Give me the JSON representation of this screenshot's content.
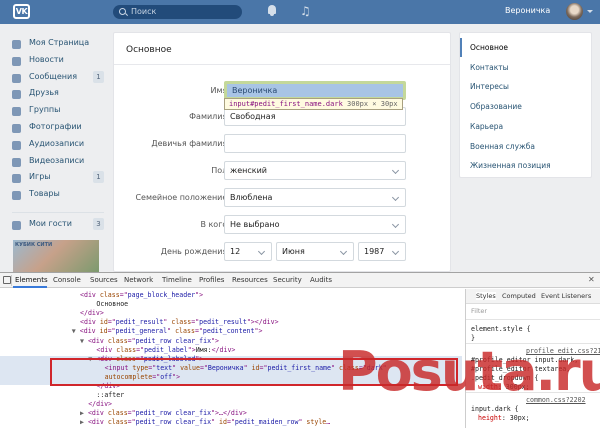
{
  "topbar": {
    "logo": "VK",
    "search_placeholder": "Поиск",
    "user_name": "Вероничка"
  },
  "left_menu": {
    "items": [
      {
        "label": "Моя Страница",
        "icon": "home-icon"
      },
      {
        "label": "Новости",
        "icon": "news-icon"
      },
      {
        "label": "Сообщения",
        "icon": "messages-icon",
        "count": "1"
      },
      {
        "label": "Друзья",
        "icon": "friends-icon"
      },
      {
        "label": "Группы",
        "icon": "groups-icon"
      },
      {
        "label": "Фотографии",
        "icon": "photos-icon"
      },
      {
        "label": "Аудиозаписи",
        "icon": "audio-icon"
      },
      {
        "label": "Видеозаписи",
        "icon": "video-icon"
      },
      {
        "label": "Игры",
        "icon": "games-icon",
        "count": "1"
      },
      {
        "label": "Товары",
        "icon": "goods-icon"
      }
    ],
    "guests": {
      "label": "Мои гости",
      "count": "3"
    },
    "ad_text": "КУБИК СИТИ"
  },
  "main": {
    "title": "Основное",
    "fields": {
      "first_name": {
        "label": "Имя:",
        "value": "Вероничка"
      },
      "last_name": {
        "label": "Фамилия:",
        "value": "Свободная"
      },
      "maiden_name": {
        "label": "Девичья фамилия:",
        "value": ""
      },
      "gender": {
        "label": "Пол:",
        "value": "женский"
      },
      "relationship": {
        "label": "Семейное положение:",
        "value": "Влюблена"
      },
      "with_whom": {
        "label": "В кого:",
        "value": "Не выбрано"
      },
      "birthday": {
        "label": "День рождения:",
        "day": "12",
        "month": "Июня",
        "year": "1987"
      }
    },
    "tooltip": {
      "selector": "input#pedit_first_name.dark",
      "size": "300px × 30px"
    }
  },
  "right_menu": {
    "items": [
      {
        "label": "Основное",
        "active": true
      },
      {
        "label": "Контакты"
      },
      {
        "label": "Интересы"
      },
      {
        "label": "Образование"
      },
      {
        "label": "Карьера"
      },
      {
        "label": "Военная служба"
      },
      {
        "label": "Жизненная позиция"
      }
    ]
  },
  "devtools": {
    "tabs": [
      "Elements",
      "Console",
      "Sources",
      "Network",
      "Timeline",
      "Profiles",
      "Resources",
      "Security",
      "Audits"
    ],
    "active_tab": "Elements",
    "dom_lines": [
      {
        "indent": 10,
        "tri": "",
        "parts": [
          [
            "t",
            "<div "
          ],
          [
            "a",
            "class"
          ],
          [
            "t",
            "=\""
          ],
          [
            "v",
            "page_block_header"
          ],
          [
            "t",
            "\">"
          ]
        ]
      },
      {
        "indent": 12,
        "tri": "",
        "parts": [
          [
            "x",
            "Основное"
          ]
        ]
      },
      {
        "indent": 10,
        "tri": "",
        "parts": [
          [
            "t",
            "</div>"
          ]
        ]
      },
      {
        "indent": 10,
        "tri": "",
        "parts": [
          [
            "t",
            "<div "
          ],
          [
            "a",
            "id"
          ],
          [
            "t",
            "=\""
          ],
          [
            "v",
            "pedit_result"
          ],
          [
            "t",
            "\" "
          ],
          [
            "a",
            "class"
          ],
          [
            "t",
            "=\""
          ],
          [
            "v",
            "pedit_result"
          ],
          [
            "t",
            "\"></div>"
          ]
        ]
      },
      {
        "indent": 9,
        "tri": "▼",
        "parts": [
          [
            "t",
            "<div "
          ],
          [
            "a",
            "id"
          ],
          [
            "t",
            "=\""
          ],
          [
            "v",
            "pedit_general"
          ],
          [
            "t",
            "\" "
          ],
          [
            "a",
            "class"
          ],
          [
            "t",
            "=\""
          ],
          [
            "v",
            "pedit_content"
          ],
          [
            "t",
            "\">"
          ]
        ]
      },
      {
        "indent": 10,
        "tri": "▼",
        "parts": [
          [
            "t",
            "<div "
          ],
          [
            "a",
            "class"
          ],
          [
            "t",
            "=\""
          ],
          [
            "v",
            "pedit_row clear_fix"
          ],
          [
            "t",
            "\">"
          ]
        ]
      },
      {
        "indent": 12,
        "tri": "",
        "parts": [
          [
            "t",
            "<div "
          ],
          [
            "a",
            "class"
          ],
          [
            "t",
            "=\""
          ],
          [
            "v",
            "pedit_label"
          ],
          [
            "t",
            "\">"
          ],
          [
            "x",
            "Имя:"
          ],
          [
            "t",
            "</div>"
          ]
        ]
      },
      {
        "indent": 11,
        "tri": "▼",
        "parts": [
          [
            "t",
            "<div "
          ],
          [
            "a",
            "class"
          ],
          [
            "t",
            "=\""
          ],
          [
            "v",
            "pedit_labeled"
          ],
          [
            "t",
            "\">"
          ]
        ]
      },
      {
        "indent": 13,
        "tri": "",
        "parts": [
          [
            "t",
            "<input "
          ],
          [
            "a",
            "type"
          ],
          [
            "t",
            "=\""
          ],
          [
            "v",
            "text"
          ],
          [
            "t",
            "\" "
          ],
          [
            "a",
            "value"
          ],
          [
            "t",
            "=\""
          ],
          [
            "v",
            "Вероничка"
          ],
          [
            "t",
            "\" "
          ],
          [
            "a",
            "id"
          ],
          [
            "t",
            "=\""
          ],
          [
            "v",
            "pedit_first_name"
          ],
          [
            "t",
            "\" "
          ],
          [
            "a",
            "class"
          ],
          [
            "t",
            "=\""
          ],
          [
            "v",
            "dark"
          ],
          [
            "t",
            "\""
          ]
        ]
      },
      {
        "indent": 13,
        "tri": "",
        "parts": [
          [
            "a",
            "autocomplete"
          ],
          [
            "t",
            "=\""
          ],
          [
            "v",
            "off"
          ],
          [
            "t",
            "\">"
          ]
        ]
      },
      {
        "indent": 12,
        "tri": "",
        "parts": [
          [
            "t",
            "</div>"
          ]
        ]
      },
      {
        "indent": 12,
        "tri": "",
        "parts": [
          [
            "x",
            "::after"
          ]
        ]
      },
      {
        "indent": 11,
        "tri": "",
        "parts": [
          [
            "t",
            "</div>"
          ]
        ]
      },
      {
        "indent": 10,
        "tri": "▶",
        "parts": [
          [
            "t",
            "<div "
          ],
          [
            "a",
            "class"
          ],
          [
            "t",
            "=\""
          ],
          [
            "v",
            "pedit_row clear_fix"
          ],
          [
            "t",
            "\">…</div>"
          ]
        ]
      },
      {
        "indent": 10,
        "tri": "▶",
        "parts": [
          [
            "t",
            "<div "
          ],
          [
            "a",
            "class"
          ],
          [
            "t",
            "=\""
          ],
          [
            "v",
            "pedit_row clear_fix"
          ],
          [
            "t",
            "\" "
          ],
          [
            "a",
            "id"
          ],
          [
            "t",
            "=\""
          ],
          [
            "v",
            "pedit_maiden_row"
          ],
          [
            "t",
            "\" "
          ],
          [
            "a",
            "style"
          ],
          [
            "t",
            "…"
          ]
        ]
      }
    ],
    "styles_tabs": [
      "Styles",
      "Computed",
      "Event Listeners"
    ],
    "filter_placeholder": "Filter",
    "styles_lines": [
      {
        "kind": "text",
        "text": "element.style {"
      },
      {
        "kind": "text",
        "text": "}"
      },
      {
        "kind": "link",
        "text": "profile_edit.css?2134"
      },
      {
        "kind": "text",
        "text": "#profile_editor input.dark,"
      },
      {
        "kind": "text",
        "text": "#profile_editor textarea,"
      },
      {
        "kind": "text",
        "text": ".pedit_dropdown {"
      },
      {
        "kind": "prop",
        "name": "width",
        "value": ": 300px;"
      },
      {
        "kind": "link",
        "text": "common.css?2202"
      },
      {
        "kind": "text",
        "text": "input.dark {"
      },
      {
        "kind": "prop",
        "name": "height",
        "value": ": 30px;"
      }
    ]
  },
  "watermark": "Posuta.ru",
  "colors": {
    "vk_blue": "#4a76a8",
    "highlight_red": "#d0262b"
  }
}
